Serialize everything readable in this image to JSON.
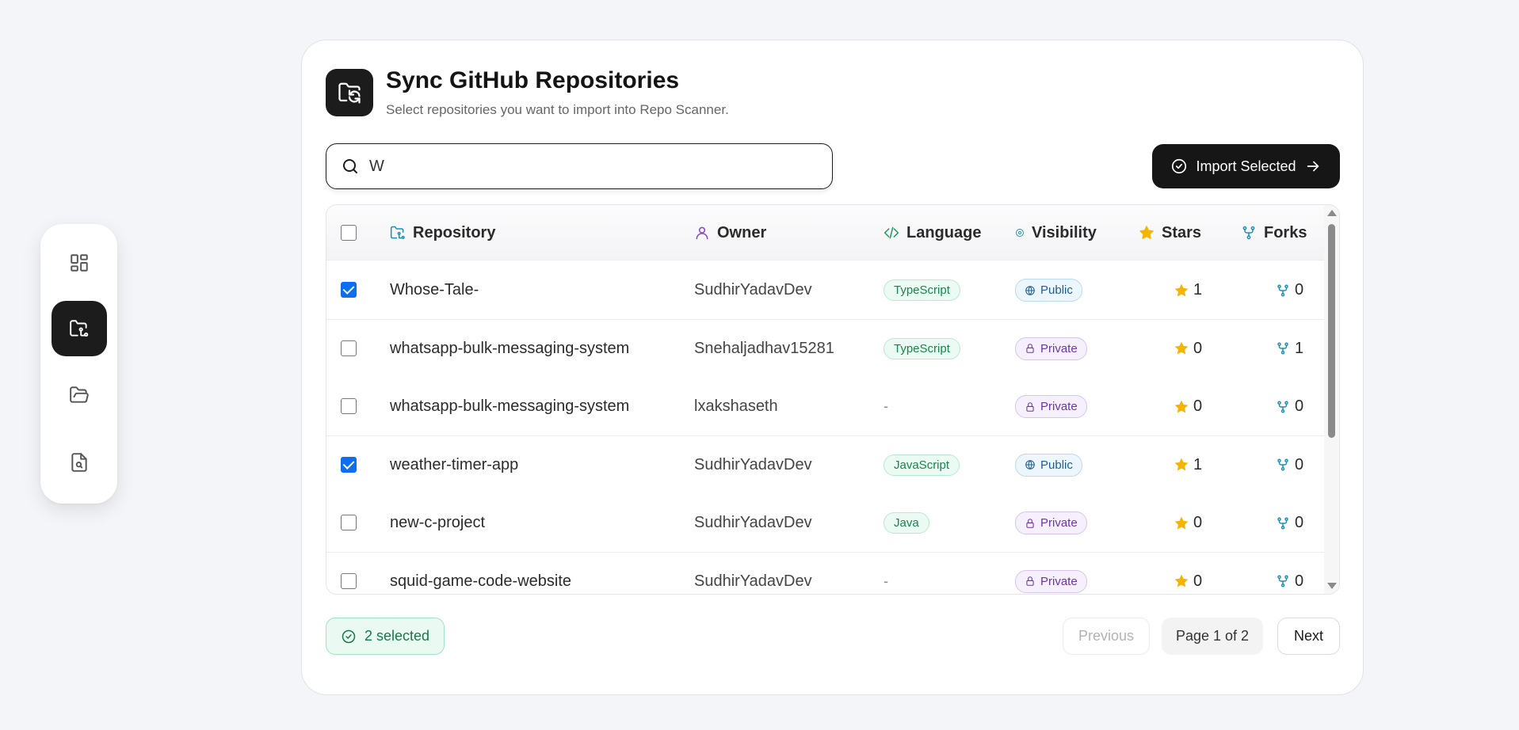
{
  "sidebar": {
    "items": [
      {
        "name": "dashboard",
        "icon": "dashboard-icon",
        "active": false
      },
      {
        "name": "sync-repos",
        "icon": "folder-git-icon",
        "active": true
      },
      {
        "name": "repositories",
        "icon": "folder-open-icon",
        "active": false
      },
      {
        "name": "scan",
        "icon": "file-search-icon",
        "active": false
      }
    ]
  },
  "header": {
    "icon": "folder-sync-icon",
    "title": "Sync GitHub Repositories",
    "subtitle": "Select repositories you want to import into Repo Scanner."
  },
  "search": {
    "value": "W",
    "placeholder": ""
  },
  "import_button": {
    "label": "Import Selected"
  },
  "table": {
    "columns": [
      {
        "label": "Repository",
        "icon": "folder-git-icon",
        "icon_color": "#1a8fb5"
      },
      {
        "label": "Owner",
        "icon": "user-icon",
        "icon_color": "#8a44c8"
      },
      {
        "label": "Language",
        "icon": "code-icon",
        "icon_color": "#1a9c5a"
      },
      {
        "label": "Visibility",
        "icon": "eye-icon",
        "icon_color": "#1a8fb5"
      },
      {
        "label": "Stars",
        "icon": "star-icon",
        "icon_color": "#f5b400"
      },
      {
        "label": "Forks",
        "icon": "fork-icon",
        "icon_color": "#1a8fb5"
      }
    ],
    "rows": [
      {
        "checked": true,
        "repo": "Whose-Tale-",
        "owner": "SudhirYadavDev",
        "language": "TypeScript",
        "visibility": "Public",
        "stars": "1",
        "forks": "0"
      },
      {
        "checked": false,
        "repo": "whatsapp-bulk-messaging-system",
        "owner": "Snehaljadhav15281",
        "language": "TypeScript",
        "visibility": "Private",
        "stars": "0",
        "forks": "1"
      },
      {
        "checked": false,
        "repo": "whatsapp-bulk-messaging-system",
        "owner": "lxakshaseth",
        "language": "-",
        "visibility": "Private",
        "stars": "0",
        "forks": "0"
      },
      {
        "checked": true,
        "repo": "weather-timer-app",
        "owner": "SudhirYadavDev",
        "language": "JavaScript",
        "visibility": "Public",
        "stars": "1",
        "forks": "0"
      },
      {
        "checked": false,
        "repo": "new-c-project",
        "owner": "SudhirYadavDev",
        "language": "Java",
        "visibility": "Private",
        "stars": "0",
        "forks": "0"
      },
      {
        "checked": false,
        "repo": "squid-game-code-website",
        "owner": "SudhirYadavDev",
        "language": "-",
        "visibility": "Private",
        "stars": "0",
        "forks": "0"
      }
    ]
  },
  "footer": {
    "selected_label": "2 selected",
    "previous_label": "Previous",
    "page_label": "Page 1 of 2",
    "next_label": "Next"
  }
}
